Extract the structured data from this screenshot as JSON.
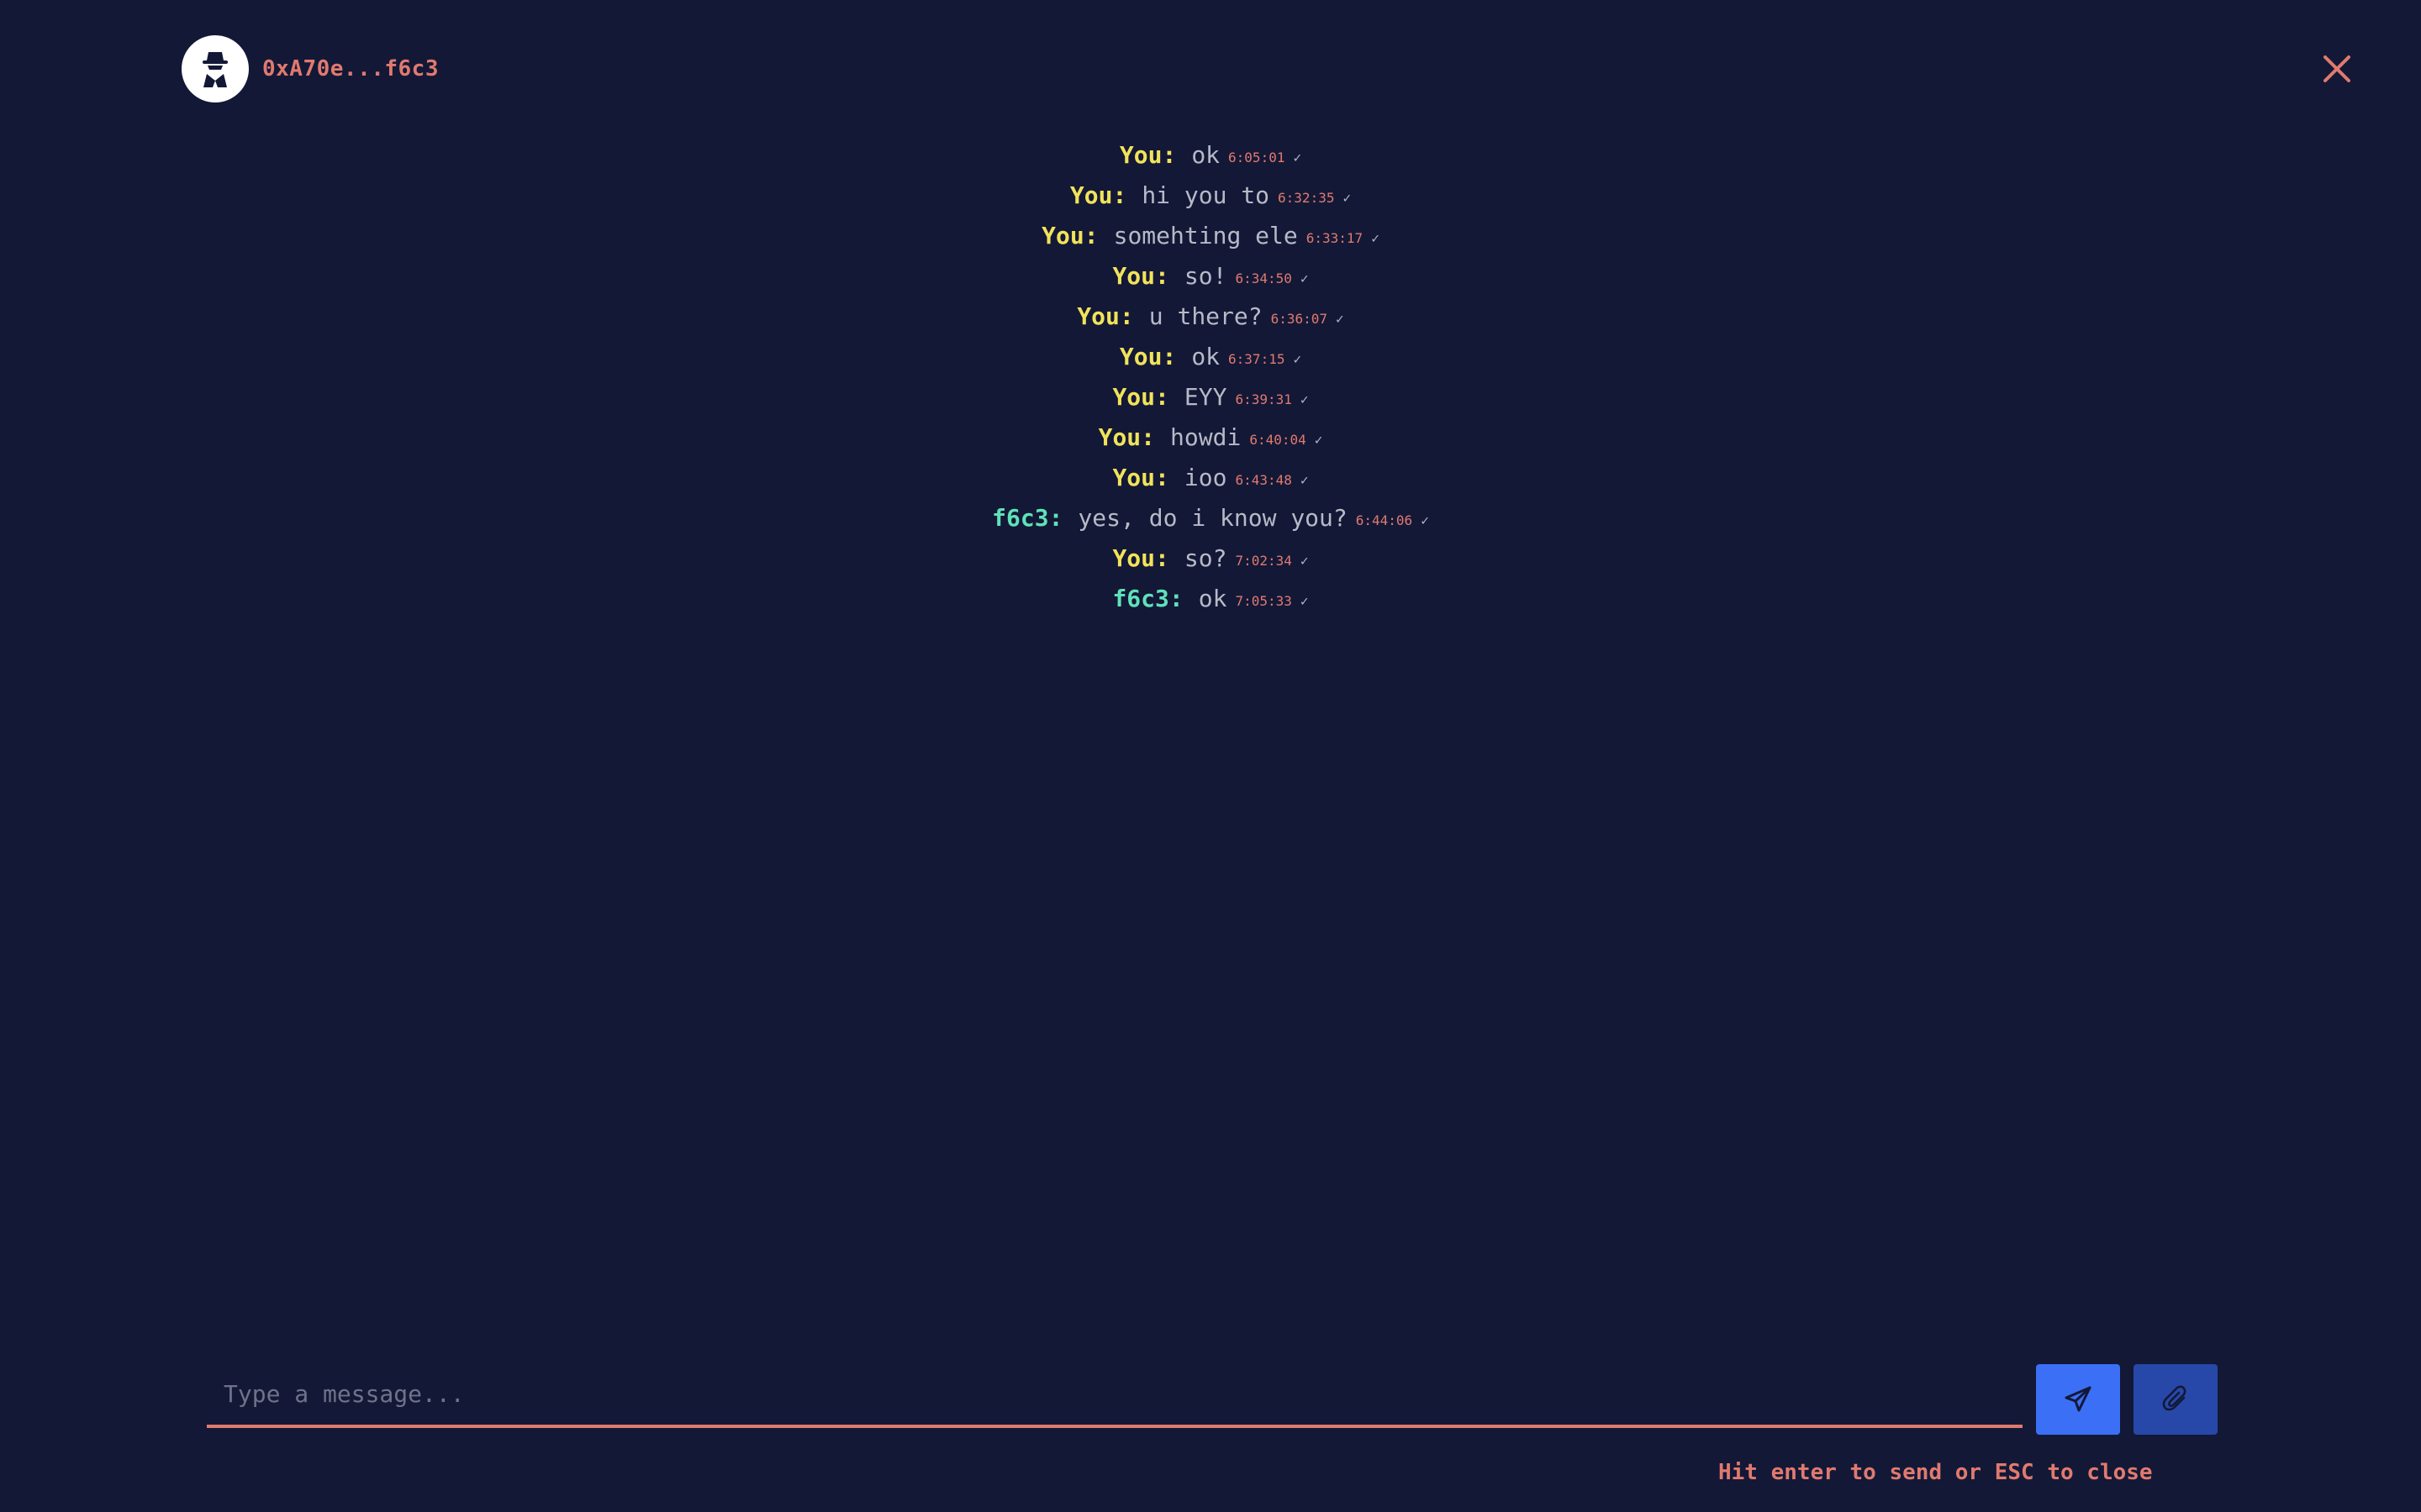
{
  "header": {
    "contact_name": "0xA70e...f6c3",
    "avatar_icon": "spy-icon"
  },
  "close_icon": "close-icon",
  "messages": [
    {
      "sender": "You:",
      "text": "ok",
      "time": "6:05:01",
      "status": "✓",
      "type": "self"
    },
    {
      "sender": "You:",
      "text": "hi you to",
      "time": "6:32:35",
      "status": "✓",
      "type": "self"
    },
    {
      "sender": "You:",
      "text": "somehting ele",
      "time": "6:33:17",
      "status": "✓",
      "type": "self"
    },
    {
      "sender": "You:",
      "text": "so!",
      "time": "6:34:50",
      "status": "✓",
      "type": "self"
    },
    {
      "sender": "You:",
      "text": "u there?",
      "time": "6:36:07",
      "status": "✓",
      "type": "self"
    },
    {
      "sender": "You:",
      "text": "ok",
      "time": "6:37:15",
      "status": "✓",
      "type": "self"
    },
    {
      "sender": "You:",
      "text": "EYY",
      "time": "6:39:31",
      "status": "✓",
      "type": "self"
    },
    {
      "sender": "You:",
      "text": "howdi",
      "time": "6:40:04",
      "status": "✓",
      "type": "self"
    },
    {
      "sender": "You:",
      "text": "ioo",
      "time": "6:43:48",
      "status": "✓",
      "type": "self"
    },
    {
      "sender": "f6c3:",
      "text": "yes, do i know you?",
      "time": "6:44:06",
      "status": "✓",
      "type": "peer"
    },
    {
      "sender": "You:",
      "text": "so?",
      "time": "7:02:34",
      "status": "✓",
      "type": "self"
    },
    {
      "sender": "f6c3:",
      "text": "ok",
      "time": "7:05:33",
      "status": "✓",
      "type": "peer"
    }
  ],
  "composer": {
    "placeholder": "Type a message...",
    "value": "",
    "send_icon": "send-icon",
    "attach_icon": "paperclip-icon"
  },
  "hint": "Hit enter to send or ESC to close",
  "colors": {
    "background": "#131837",
    "accent": "#e07a6e",
    "self_sender": "#f1e35a",
    "peer_sender": "#5fe2b8",
    "send_button": "#3b6ff5",
    "attach_button": "#2748a8"
  }
}
